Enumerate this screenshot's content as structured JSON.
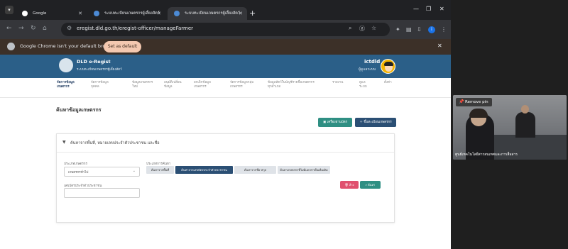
{
  "browser": {
    "tabs": [
      {
        "label": "Google",
        "active": false
      },
      {
        "label": "ระบบทะเบียนเกษตรกรผู้เลี้ยงสัตว์",
        "active": false
      },
      {
        "label": "ระบบทะเบียนเกษตรกรผู้เลี้ยงสัตว์",
        "active": true
      }
    ],
    "new_tab": "+",
    "url": "eregist.dld.go.th/eregist-officer/manageFarmer",
    "profile_initial": "i"
  },
  "infobar": {
    "message": "Google Chrome isn't your default browser",
    "button": "Set as default"
  },
  "app": {
    "brand": "DLD e-Regist",
    "brand_sub": "ระบบทะเบียนเกษตรกรผู้เลี้ยงสัตว์",
    "user_name": "ictdld",
    "user_role": "ผู้ดูแลระบบ",
    "menu": [
      {
        "label": "จัดการข้อมูลเกษตรกร",
        "active": true
      },
      {
        "label": "จัดการข้อมูลบุคคล",
        "active": false
      },
      {
        "label": "ข้อมูลเกษตรกรใหม่",
        "active": false
      },
      {
        "label": "อนุมัติเปลี่ยนข้อมูล",
        "active": false
      },
      {
        "label": "ยกเลิกข้อมูลเกษตรกร",
        "active": false
      },
      {
        "label": "จัดการข้อมูลกลุ่มเกษตรกร",
        "active": false
      },
      {
        "label": "ข้อมูลสัตว์ในบัญชีรายชื่อเกษตรกรทุกอำเภอ",
        "active": false
      },
      {
        "label": "รายงาน",
        "active": false
      },
      {
        "label": "ดูแลระบบ",
        "active": false
      },
      {
        "label": "ตั้งค่า",
        "active": false
      }
    ]
  },
  "main": {
    "title": "ค้นหาข้อมูลเกษตรกร",
    "btn_farmer_list": "เครื่องอ่านบัตร",
    "btn_add_farmer": "ขึ้นทะเบียนเกษตรกร",
    "search_panel_title": "ค้นหาจากพื้นที่, หมายเลขประจำตัวประชาชน และชื่อ",
    "label_farmer_type": "ประเภทเกษตรกร",
    "select_farmer_type_value": "เกษตรกรทั่วไป",
    "label_search_type": "ประเภทการค้นหา",
    "label_id_card": "เลขบัตรประจำตัวประชาชน",
    "search_types": [
      {
        "label": "ค้นหาจากพื้นที่",
        "active": false
      },
      {
        "label": "ค้นหาจากเลขบัตรประจำตัวประชาชน",
        "active": true
      },
      {
        "label": "ค้นหาจากชื่อ-สกุล",
        "active": false
      },
      {
        "label": "ค้นหาเกษตรกรที่ไม่มีเอกสารอื่นเพิ่มเติม",
        "active": false
      }
    ],
    "btn_clear": "ล้าง",
    "btn_search": "ค้นหา"
  },
  "video": {
    "pin_label": "Remove pin",
    "participant_name": "ศูนย์เทคโนโลยีสารสนเทศและการสื่อสาร"
  }
}
